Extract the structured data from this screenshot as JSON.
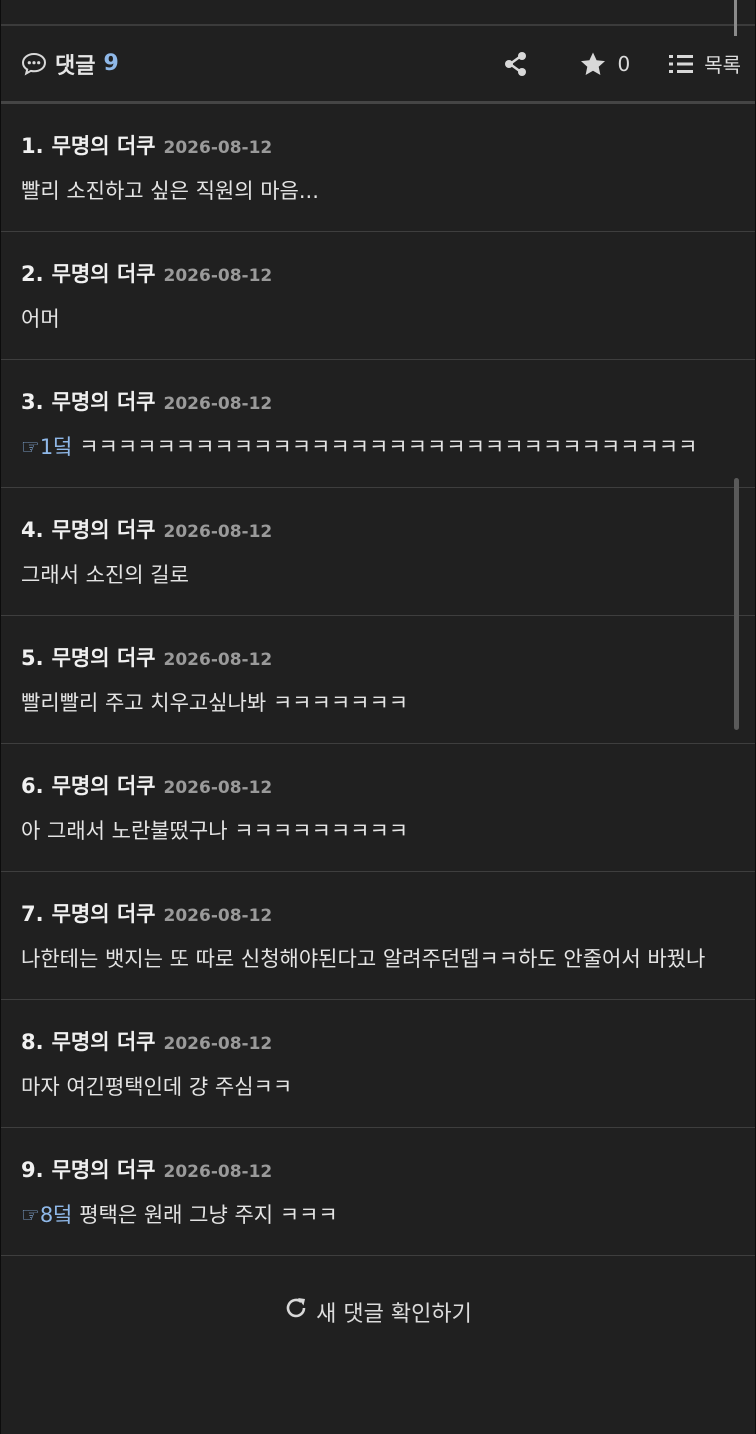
{
  "comment_bar": {
    "label": "댓글",
    "count": "9",
    "favorite_count": "0",
    "list_label": "목록"
  },
  "comments": [
    {
      "num": "1.",
      "author": "무명의 더쿠",
      "date": "2026-08-12",
      "ref": "",
      "text": "빨리 소진하고 싶은 직원의 마음..."
    },
    {
      "num": "2.",
      "author": "무명의 더쿠",
      "date": "2026-08-12",
      "ref": "",
      "text": "어머"
    },
    {
      "num": "3.",
      "author": "무명의 더쿠",
      "date": "2026-08-12",
      "ref": "☞1덬",
      "text": " ㅋㅋㅋㅋㅋㅋㅋㅋㅋㅋㅋㅋㅋㅋㅋㅋㅋㅋㅋㅋㅋㅋㅋㅋㅋㅋㅋㅋㅋㅋㅋㅋ"
    },
    {
      "num": "4.",
      "author": "무명의 더쿠",
      "date": "2026-08-12",
      "ref": "",
      "text": "그래서 소진의 길로"
    },
    {
      "num": "5.",
      "author": "무명의 더쿠",
      "date": "2026-08-12",
      "ref": "",
      "text": "빨리빨리 주고 치우고싶나봐 ㅋㅋㅋㅋㅋㅋㅋ"
    },
    {
      "num": "6.",
      "author": "무명의 더쿠",
      "date": "2026-08-12",
      "ref": "",
      "text": "아 그래서 노란불떴구나 ㅋㅋㅋㅋㅋㅋㅋㅋㅋ"
    },
    {
      "num": "7.",
      "author": "무명의 더쿠",
      "date": "2026-08-12",
      "ref": "",
      "text": "나한테는 뱃지는 또 따로 신청해야된다고 알려주던뎁ㅋㅋ하도 안줄어서 바꿨나"
    },
    {
      "num": "8.",
      "author": "무명의 더쿠",
      "date": "2026-08-12",
      "ref": "",
      "text": "마자 여긴평택인데 걍 주심ㅋㅋ"
    },
    {
      "num": "9.",
      "author": "무명의 더쿠",
      "date": "2026-08-12",
      "ref": "☞8덬",
      "text": " 평택은 원래 그냥 주지 ㅋㅋㅋ"
    }
  ],
  "footer": {
    "new_comments_label": "새 댓글 확인하기"
  },
  "icons": {
    "comment": "speech-bubble-icon",
    "share": "share-icon",
    "favorite": "star-icon",
    "list": "list-icon",
    "refresh": "refresh-icon"
  },
  "colors": {
    "background": "#202020",
    "accent": "#8fb8e8",
    "text": "#e4e4e4",
    "muted": "#9a9a9a"
  }
}
